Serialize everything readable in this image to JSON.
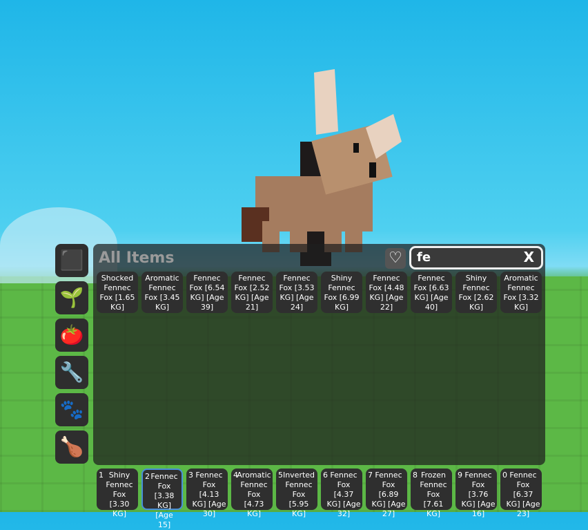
{
  "panel": {
    "title": "All Items",
    "search_value": "fe",
    "clear_label": "X"
  },
  "sidebar": [
    {
      "icon": "cube-icon",
      "glyph": "⬛"
    },
    {
      "icon": "sprout-icon",
      "glyph": "🌱"
    },
    {
      "icon": "tomato-icon",
      "glyph": "🍅"
    },
    {
      "icon": "wrench-icon",
      "glyph": "🔧"
    },
    {
      "icon": "paw-icon",
      "glyph": "🐾"
    },
    {
      "icon": "drumstick-icon",
      "glyph": "🍗"
    }
  ],
  "items": [
    "Shocked Fennec Fox [1.65 KG]",
    "Aromatic Fennec Fox [3.45 KG]",
    "Fennec Fox [6.54 KG] [Age 39]",
    "Fennec Fox [2.52 KG] [Age 21]",
    "Fennec Fox [3.53 KG] [Age 24]",
    "Shiny Fennec Fox [6.99 KG]",
    "Fennec Fox [4.48 KG] [Age 22]",
    "Fennec Fox [6.63 KG] [Age 40]",
    "Shiny Fennec Fox [2.62 KG]",
    "Aromatic Fennec Fox [3.32 KG]"
  ],
  "hotbar": [
    {
      "key": "1",
      "label": "Shiny Fennec Fox [3.30 KG]"
    },
    {
      "key": "2",
      "label": "Fennec Fox [3.38 KG] [Age 15]"
    },
    {
      "key": "3",
      "label": "Fennec Fox [4.13 KG] [Age 30]"
    },
    {
      "key": "4",
      "label": "Aromatic Fennec Fox [4.73 KG]"
    },
    {
      "key": "5",
      "label": "Inverted Fennec Fox [5.95 KG]"
    },
    {
      "key": "6",
      "label": "Fennec Fox [4.37 KG] [Age 32]"
    },
    {
      "key": "7",
      "label": "Fennec Fox [6.89 KG] [Age 27]"
    },
    {
      "key": "8",
      "label": "Frozen Fennec Fox [7.61 KG]"
    },
    {
      "key": "9",
      "label": "Fennec Fox [3.76 KG] [Age 16]"
    },
    {
      "key": "0",
      "label": "Fennec Fox [6.37 KG] [Age 23]"
    }
  ],
  "selected_hotbar": 1
}
